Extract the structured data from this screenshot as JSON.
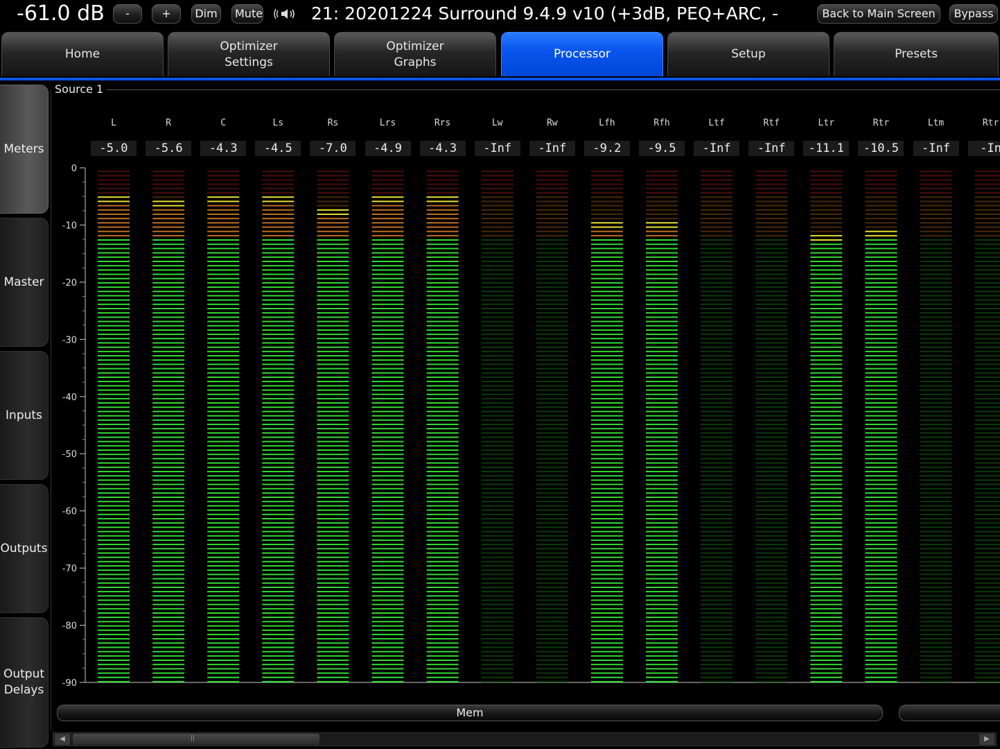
{
  "topbar": {
    "volume": "-61.0 dB",
    "minus_label": "-",
    "plus_label": "+",
    "dim_label": "Dim",
    "mute_label": "Mute",
    "speaker_icon": "speaker-waves-icon",
    "preset_title": "21: 20201224 Surround 9.4.9 v10 (+3dB, PEQ+ARC, -",
    "back_label": "Back to Main Screen",
    "bypass_label": "Bypass"
  },
  "tabs": [
    {
      "label": "Home"
    },
    {
      "label": "Optimizer\nSettings"
    },
    {
      "label": "Optimizer\nGraphs"
    },
    {
      "label": "Processor"
    },
    {
      "label": "Setup"
    },
    {
      "label": "Presets"
    }
  ],
  "active_tab": "Processor",
  "sidebar": [
    {
      "label": "Meters"
    },
    {
      "label": "Master"
    },
    {
      "label": "Inputs"
    },
    {
      "label": "Outputs"
    },
    {
      "label": "Output\nDelays"
    }
  ],
  "active_sidebar": "Meters",
  "panel": {
    "title": "Source 1"
  },
  "meter": {
    "scale_ticks": [
      "0",
      "-10",
      "-20",
      "-30",
      "-40",
      "-50",
      "-60",
      "-70",
      "-80",
      "-90"
    ],
    "min_db": -90,
    "max_db": 0,
    "colors": {
      "green": "#33dd33",
      "green_dim": "#0c3a0c",
      "yellow": "#e8e030",
      "orange": "#c07020",
      "orange_dim": "#4a2a0a",
      "red": "#e02020",
      "red_dim": "#4a0c0c"
    }
  },
  "channels": [
    {
      "name": "L",
      "value": "-5.0",
      "peak": -5.0
    },
    {
      "name": "R",
      "value": "-5.6",
      "peak": -5.6
    },
    {
      "name": "C",
      "value": "-4.3",
      "peak": -4.3
    },
    {
      "name": "Ls",
      "value": "-4.5",
      "peak": -4.5
    },
    {
      "name": "Rs",
      "value": "-7.0",
      "peak": -7.0
    },
    {
      "name": "Lrs",
      "value": "-4.9",
      "peak": -4.9
    },
    {
      "name": "Rrs",
      "value": "-4.3",
      "peak": -4.3
    },
    {
      "name": "Lw",
      "value": "-Inf",
      "peak": null
    },
    {
      "name": "Rw",
      "value": "-Inf",
      "peak": null
    },
    {
      "name": "Lfh",
      "value": "-9.2",
      "peak": -9.2
    },
    {
      "name": "Rfh",
      "value": "-9.5",
      "peak": -9.5
    },
    {
      "name": "Ltf",
      "value": "-Inf",
      "peak": null
    },
    {
      "name": "Rtf",
      "value": "-Inf",
      "peak": null
    },
    {
      "name": "Ltr",
      "value": "-11.1",
      "peak": -11.1
    },
    {
      "name": "Rtr",
      "value": "-10.5",
      "peak": -10.5
    },
    {
      "name": "Ltm",
      "value": "-Inf",
      "peak": null
    },
    {
      "name": "Rtr",
      "value": "-In",
      "peak": null
    }
  ],
  "bottom": {
    "mem_label": "Mem"
  }
}
